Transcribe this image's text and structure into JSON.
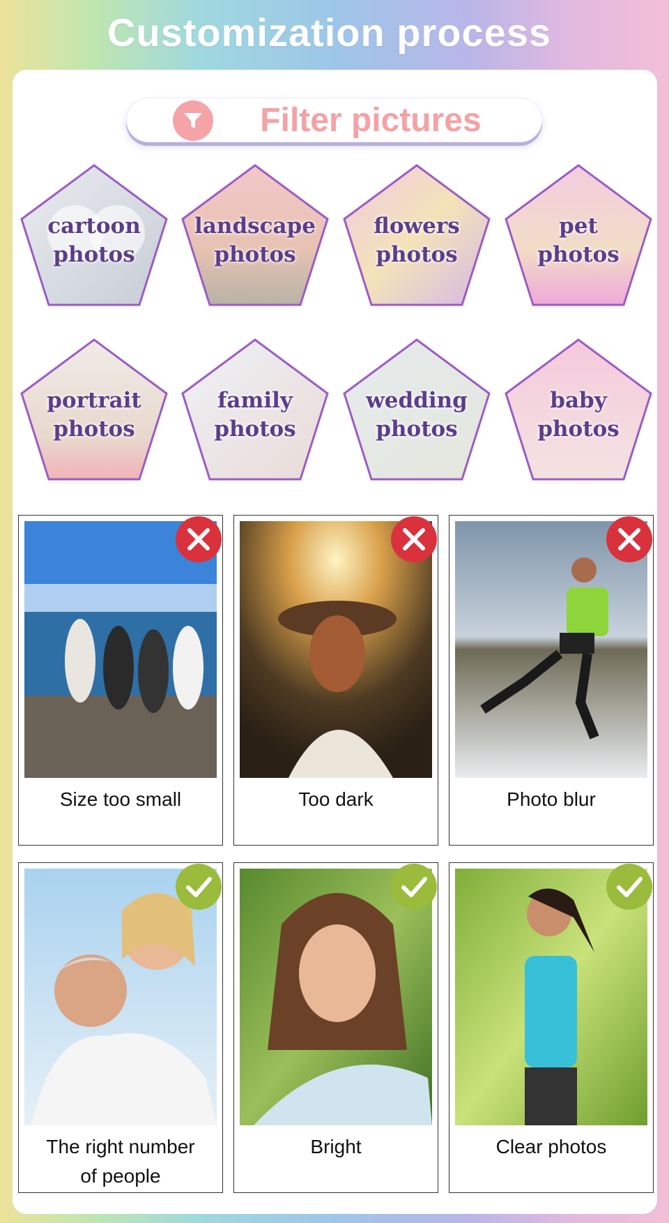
{
  "header": {
    "title": "Customization process"
  },
  "filter": {
    "label": "Filter pictures",
    "icon": "filter-funnel-icon",
    "icon_color": "#f5a3a6"
  },
  "categories": [
    {
      "line1": "cartoon",
      "line2": "photos"
    },
    {
      "line1": "landscape",
      "line2": "photos"
    },
    {
      "line1": "flowers",
      "line2": "photos"
    },
    {
      "line1": "pet",
      "line2": "photos"
    },
    {
      "line1": "portrait",
      "line2": "photos"
    },
    {
      "line1": "family",
      "line2": "photos"
    },
    {
      "line1": "wedding",
      "line2": "photos"
    },
    {
      "line1": "baby",
      "line2": "photos"
    }
  ],
  "bad_examples": [
    {
      "caption": "Size too small",
      "status": "rejected"
    },
    {
      "caption": "Too dark",
      "status": "rejected"
    },
    {
      "caption": "Photo blur",
      "status": "rejected"
    }
  ],
  "good_examples": [
    {
      "caption_line1": "The right number",
      "caption_line2": "of people",
      "status": "accepted"
    },
    {
      "caption_line1": "Bright",
      "caption_line2": "",
      "status": "accepted"
    },
    {
      "caption_line1": "Clear photos",
      "caption_line2": "",
      "status": "accepted"
    }
  ],
  "colors": {
    "reject": "#d9323d",
    "accept": "#9bbb3c",
    "pentagon_border": "#9b5cc4",
    "label": "#5c3d8a",
    "filter_text": "#f4a2a6"
  }
}
